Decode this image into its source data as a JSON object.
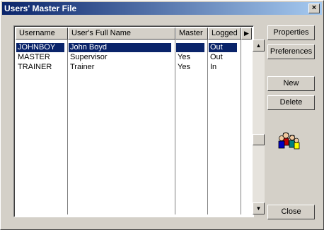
{
  "window": {
    "title": "Users' Master File",
    "close_glyph": "×"
  },
  "list": {
    "columns": [
      "Username",
      "User's Full Name",
      "Master",
      "Logged"
    ],
    "more_columns_glyph": "▶",
    "rows": [
      {
        "username": "JOHNBOY",
        "full_name": "John Boyd",
        "master": "",
        "logged": "Out",
        "selected": true
      },
      {
        "username": "MASTER",
        "full_name": "Supervisor",
        "master": "Yes",
        "logged": "Out",
        "selected": false
      },
      {
        "username": "TRAINER",
        "full_name": "Trainer",
        "master": "Yes",
        "logged": "In",
        "selected": false
      }
    ],
    "scroll_up_glyph": "▲",
    "scroll_down_glyph": "▼"
  },
  "buttons": {
    "properties": "Properties",
    "preferences": "Preferences",
    "new": "New",
    "delete": "Delete",
    "close": "Close"
  },
  "icons": {
    "users": "users-group-icon"
  },
  "colors": {
    "selection": "#0a246a",
    "title_start": "#0a246a",
    "title_end": "#a6caf0",
    "face": "#d4d0c8"
  }
}
